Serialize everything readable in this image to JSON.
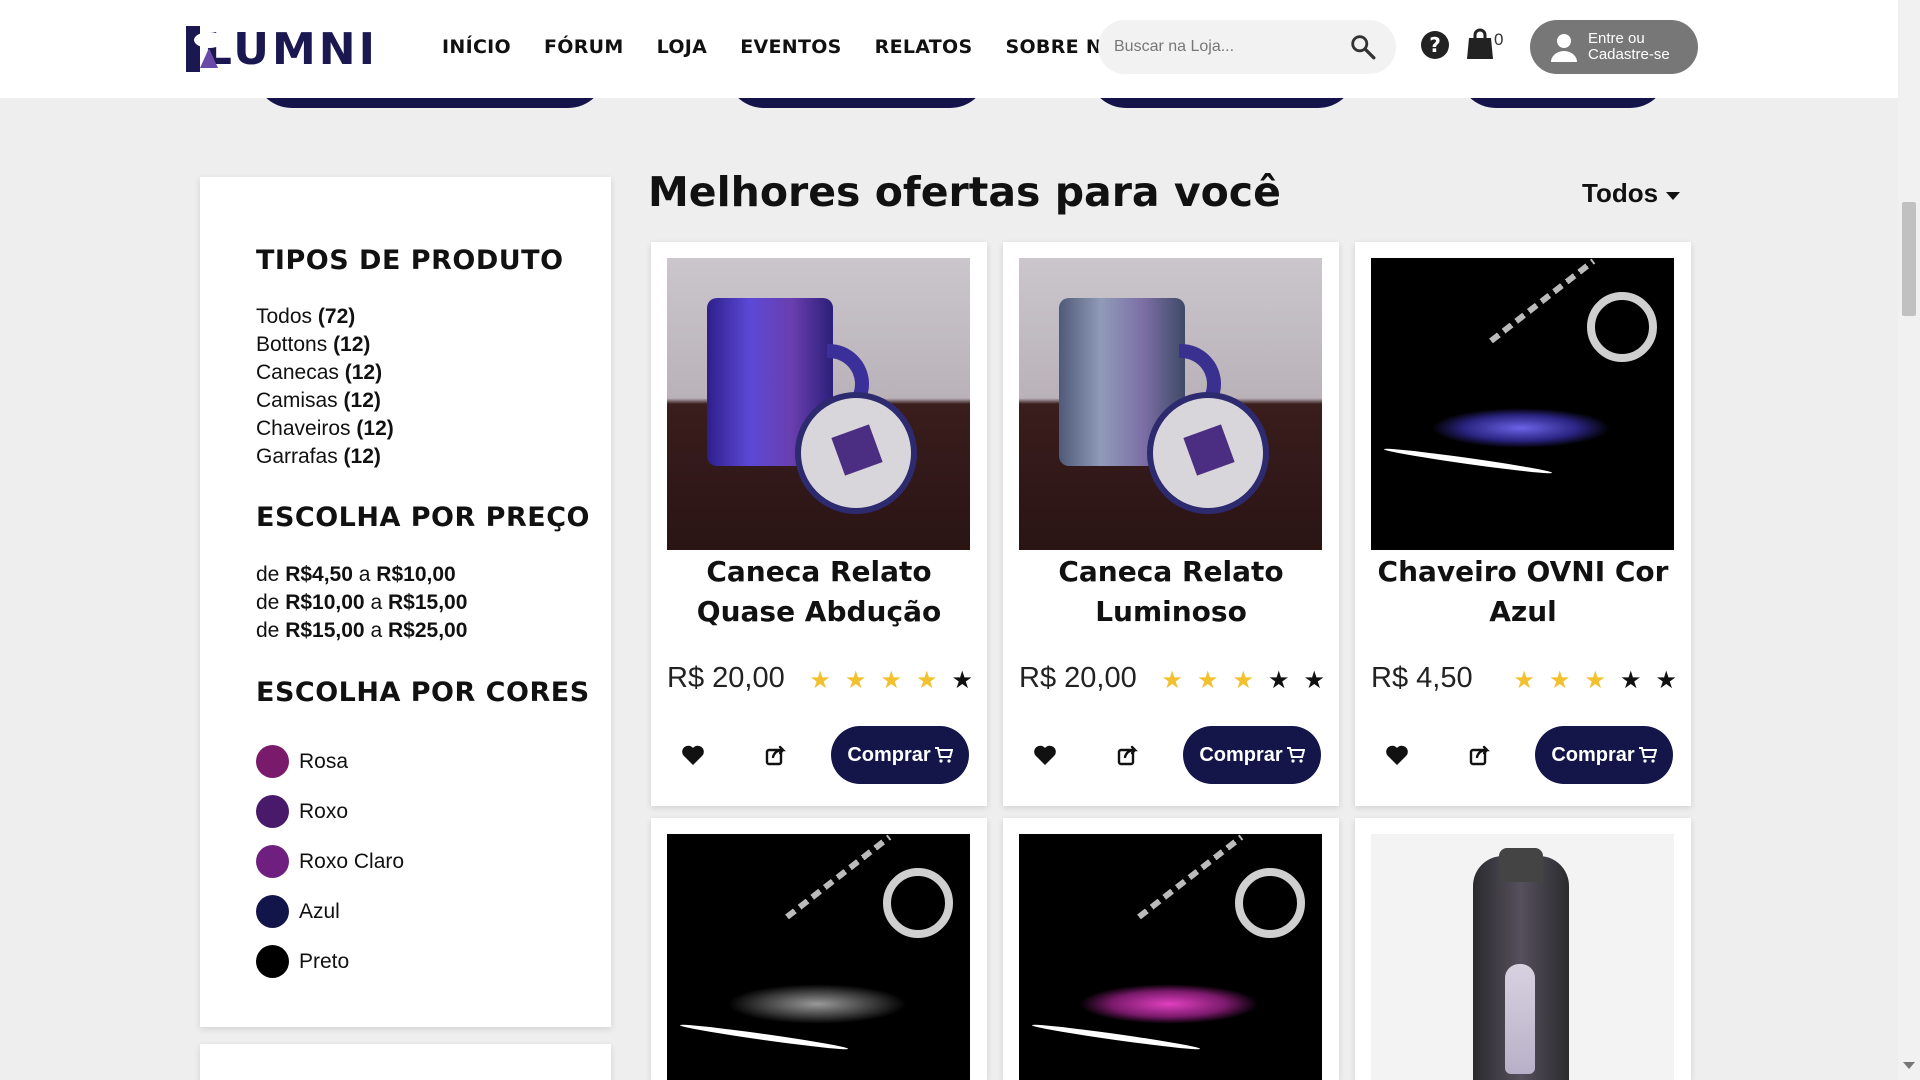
{
  "brand": {
    "name": "LUMNI"
  },
  "nav": [
    "INÍCIO",
    "FÓRUM",
    "LOJA",
    "EVENTOS",
    "RELATOS",
    "SOBRE NÓS"
  ],
  "search": {
    "placeholder": "Buscar na Loja..."
  },
  "cart": {
    "count": "0"
  },
  "login": {
    "label": "Entre ou Cadastre-se"
  },
  "sidebar": {
    "product_types_title": "TIPOS DE PRODUTO",
    "product_types": [
      {
        "label": "Todos",
        "count": "(72)"
      },
      {
        "label": "Bottons",
        "count": "(12)"
      },
      {
        "label": "Canecas",
        "count": "(12)"
      },
      {
        "label": "Camisas",
        "count": "(12)"
      },
      {
        "label": "Chaveiros",
        "count": "(12)"
      },
      {
        "label": "Garrafas",
        "count": "(12)"
      }
    ],
    "price_title": "ESCOLHA POR PREÇO",
    "price_ranges": [
      {
        "from": "R$4,50",
        "to": "R$10,00"
      },
      {
        "from": "R$10,00",
        "to": "R$15,00"
      },
      {
        "from": "R$15,00",
        "to": "R$25,00"
      }
    ],
    "price_sep_de": "de",
    "price_sep_a": "a",
    "colors_title": "ESCOLHA POR CORES",
    "colors": [
      {
        "label": "Rosa",
        "hex": "#7a1a6b"
      },
      {
        "label": "Roxo",
        "hex": "#4a1a6a"
      },
      {
        "label": "Roxo Claro",
        "hex": "#6e1f80"
      },
      {
        "label": "Azul",
        "hex": "#12154a"
      },
      {
        "label": "Preto",
        "hex": "#000000"
      }
    ]
  },
  "main": {
    "title": "Melhores ofertas para você",
    "sort": "Todos"
  },
  "products": [
    {
      "name": "Caneca Relato Quase Abdução",
      "price": "R$ 20,00",
      "rating": 4,
      "buy_label": "Comprar",
      "image": "mug-purple"
    },
    {
      "name": "Caneca Relato Luminoso",
      "price": "R$ 20,00",
      "rating": 3,
      "buy_label": "Comprar",
      "image": "mug-light"
    },
    {
      "name": "Chaveiro OVNI Cor Azul",
      "price": "R$ 4,50",
      "rating": 3,
      "buy_label": "Comprar",
      "image": "keychain-blue"
    },
    {
      "name": "",
      "price": "",
      "rating": 0,
      "buy_label": "",
      "image": "keychain-white"
    },
    {
      "name": "",
      "price": "",
      "rating": 0,
      "buy_label": "",
      "image": "keychain-pink"
    },
    {
      "name": "",
      "price": "",
      "rating": 0,
      "buy_label": "",
      "image": "bottle-alien"
    }
  ],
  "colors": {
    "accent": "#14164a",
    "star": "#f2c12e",
    "login_bg": "#777777"
  }
}
